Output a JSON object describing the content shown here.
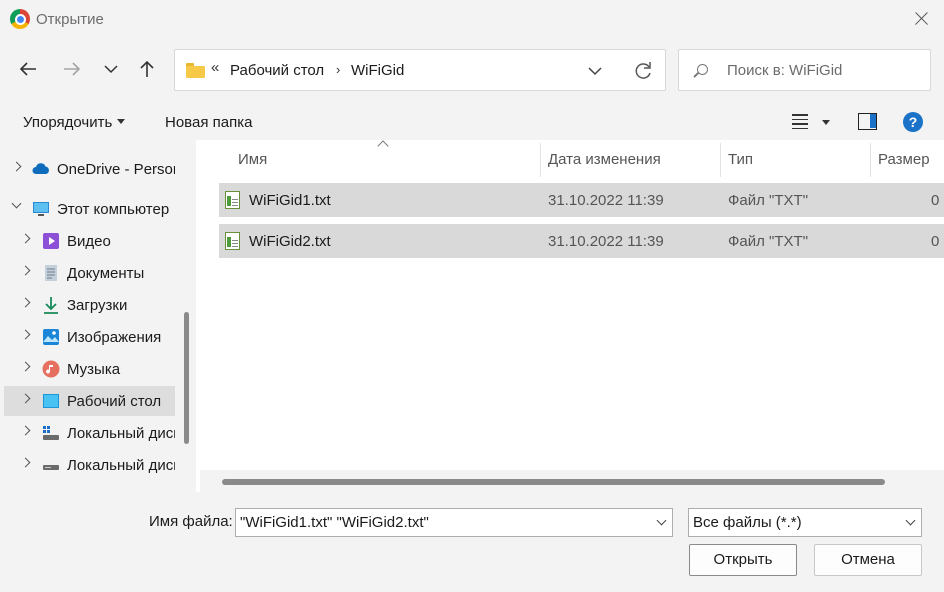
{
  "window": {
    "title": "Открытие",
    "icon": "chrome-icon"
  },
  "nav": {
    "breadcrumb_overflow": "«",
    "breadcrumb": [
      "Рабочий стол",
      "WiFiGid"
    ],
    "breadcrumb_sep": "›",
    "search_placeholder": "Поиск в: WiFiGid"
  },
  "toolbar": {
    "organize_label": "Упорядочить",
    "new_folder_label": "Новая папка",
    "help_label": "?"
  },
  "sidebar": {
    "items": [
      {
        "label": "OneDrive - Personal",
        "icon": "onedrive-icon"
      },
      {
        "label": "Этот компьютер",
        "icon": "computer-icon"
      },
      {
        "label": "Видео",
        "icon": "video-icon"
      },
      {
        "label": "Документы",
        "icon": "documents-icon"
      },
      {
        "label": "Загрузки",
        "icon": "downloads-icon"
      },
      {
        "label": "Изображения",
        "icon": "images-icon"
      },
      {
        "label": "Музыка",
        "icon": "music-icon"
      },
      {
        "label": "Рабочий стол",
        "icon": "desktop-icon"
      },
      {
        "label": "Локальный диск",
        "icon": "local-disk-icon"
      },
      {
        "label": "Локальный диск",
        "icon": "local-disk-icon"
      }
    ]
  },
  "table": {
    "columns": [
      "Имя",
      "Дата изменения",
      "Тип",
      "Размер"
    ],
    "rows": [
      {
        "name": "WiFiGid1.txt",
        "date": "31.10.2022 11:39",
        "type": "Файл \"TXT\"",
        "size": "0"
      },
      {
        "name": "WiFiGid2.txt",
        "date": "31.10.2022 11:39",
        "type": "Файл \"TXT\"",
        "size": "0"
      }
    ]
  },
  "footer": {
    "filename_label": "Имя файла:",
    "filename_value": "\"WiFiGid1.txt\" \"WiFiGid2.txt\"",
    "filter_value": "Все файлы (*.*)",
    "open_label": "Открыть",
    "cancel_label": "Отмена"
  }
}
